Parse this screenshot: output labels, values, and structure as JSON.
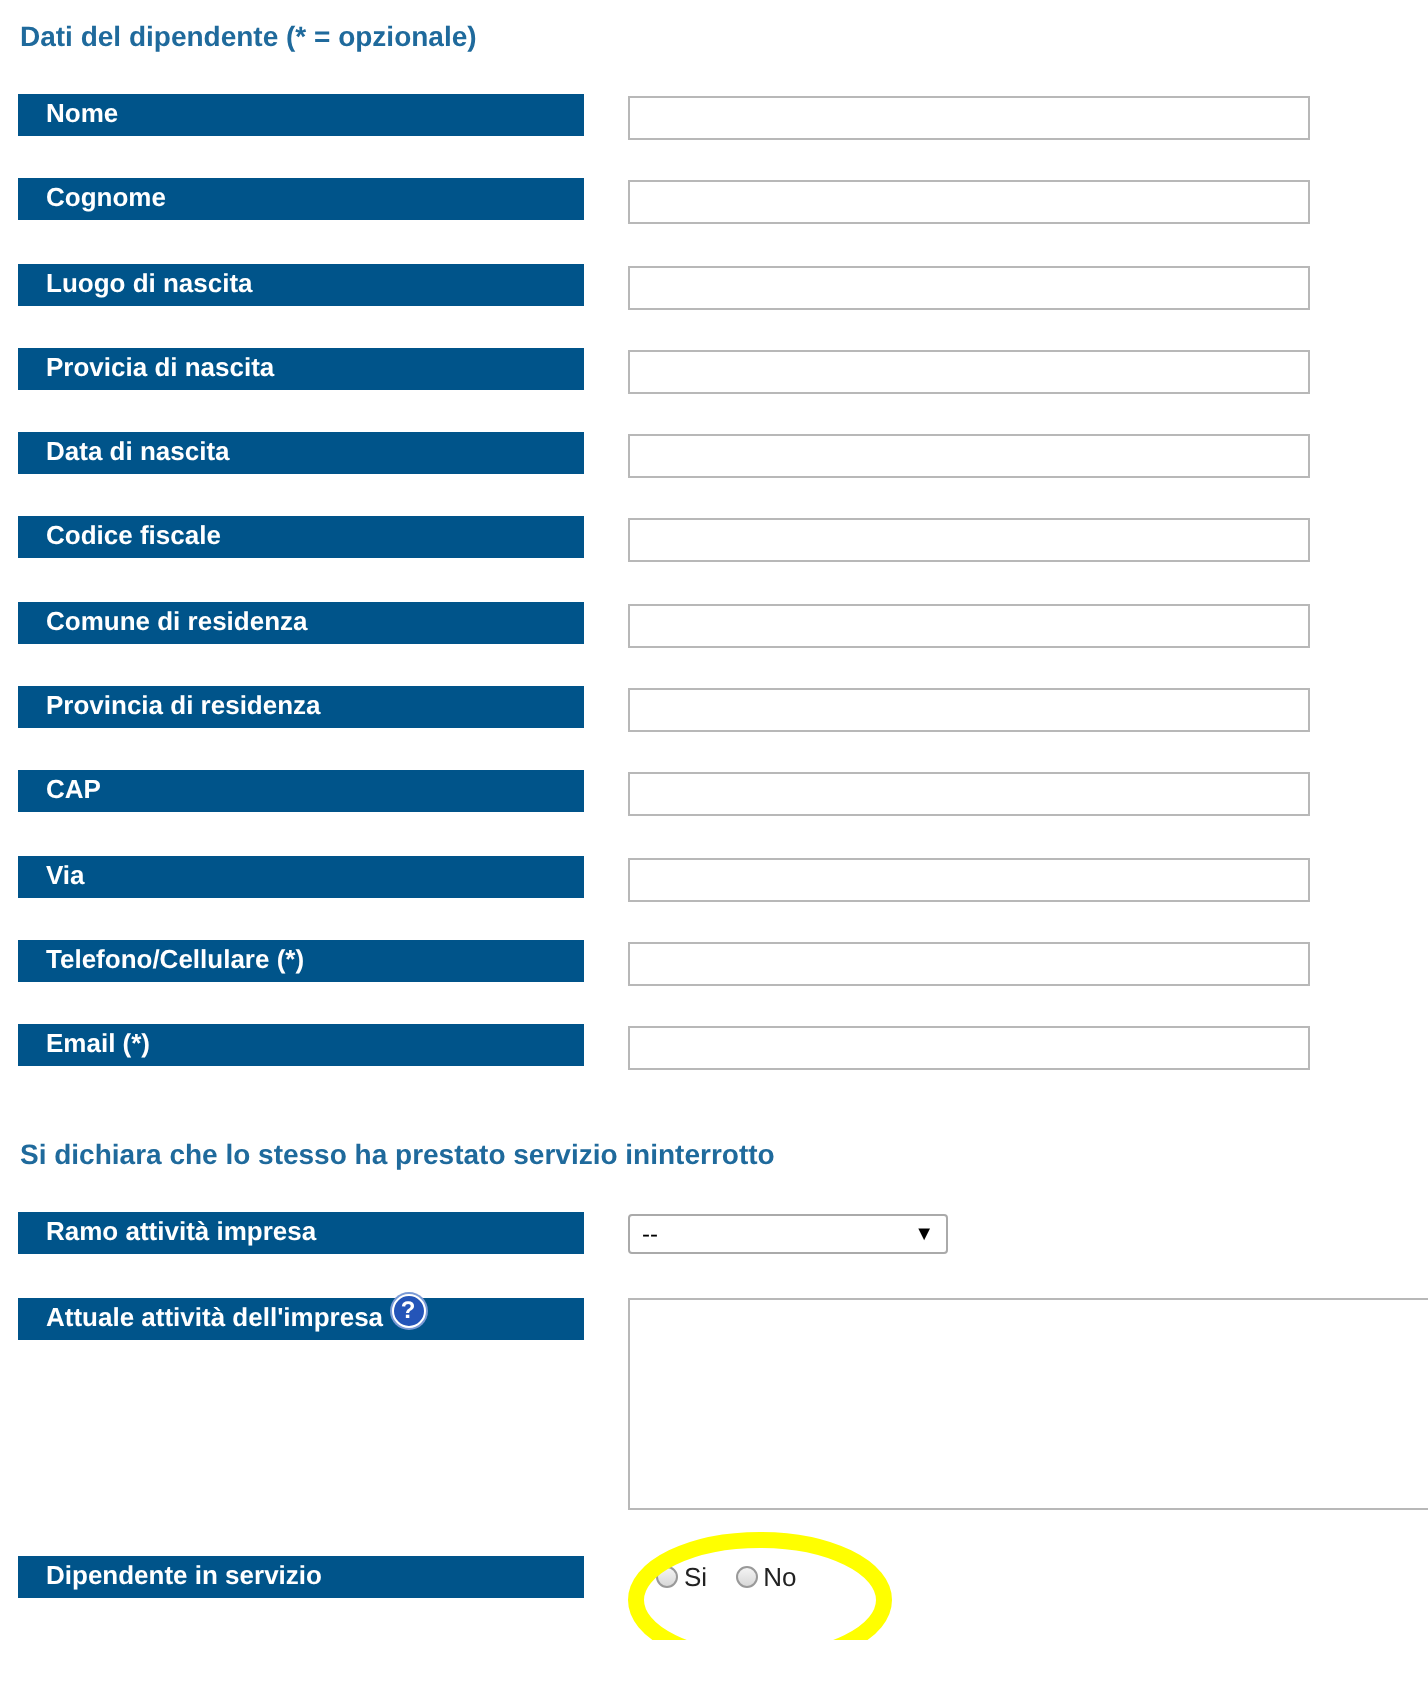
{
  "sections": [
    {
      "title": "Dati del dipendente (* = opzionale)",
      "fields": [
        {
          "kind": "text",
          "label": "Nome"
        },
        {
          "kind": "text",
          "label": "Cognome"
        },
        {
          "kind": "text",
          "label": "Luogo di nascita"
        },
        {
          "kind": "text",
          "label": "Provicia di nascita"
        },
        {
          "kind": "text",
          "label": "Data di nascita"
        },
        {
          "kind": "text",
          "label": "Codice fiscale"
        },
        {
          "kind": "text",
          "label": "Comune di residenza"
        },
        {
          "kind": "text",
          "label": "Provincia di residenza"
        },
        {
          "kind": "text",
          "label": "CAP"
        },
        {
          "kind": "text",
          "label": "Via"
        },
        {
          "kind": "text",
          "label": "Telefono/Cellulare (*)"
        },
        {
          "kind": "text",
          "label": "Email (*)"
        }
      ]
    },
    {
      "title": "Si dichiara che lo stesso ha prestato servizio ininterrotto",
      "fields": [
        {
          "kind": "select",
          "label": "Ramo attività impresa",
          "value": "--",
          "arrow": "▼"
        },
        {
          "kind": "textarea",
          "label": "Attuale attività dell'impresa",
          "help": "?"
        },
        {
          "kind": "radio",
          "label": "Dipendente in servizio",
          "highlighted": true,
          "options": [
            {
              "label": "Si",
              "selected": false
            },
            {
              "label": "No",
              "selected": false
            }
          ]
        }
      ]
    }
  ]
}
